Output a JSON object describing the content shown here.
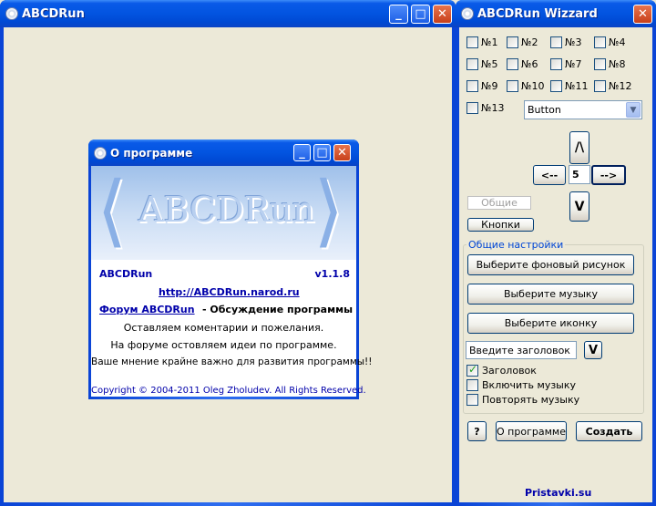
{
  "main_window": {
    "title": "ABCDRun"
  },
  "about_dialog": {
    "title": "О программе",
    "banner_text": "ABCDRun",
    "app_name": "ABCDRun",
    "version": "v1.1.8",
    "site_link": "http://ABCDRun.narod.ru",
    "forum_link": "Форум ABCDRun",
    "forum_desc": " - Обсуждение программы",
    "line1": "Оставляем коментарии и пожелания.",
    "line2": "На форуме остовляем идеи по программе.",
    "line3": "Ваше мнение крайне важно для развития программы!!",
    "copyright": "Copyright © 2004-2011 Oleg Zholudev. All Rights Reserved."
  },
  "wizard": {
    "title": "ABCDRun Wizzard",
    "checkboxes": [
      "№1",
      "№2",
      "№3",
      "№4",
      "№5",
      "№6",
      "№7",
      "№8",
      "№9",
      "№10",
      "№11",
      "№12",
      "№13"
    ],
    "style_select": "Button",
    "up_label": "/\\",
    "down_label": "V",
    "left_label": "<--",
    "right_label": "-->",
    "step_value": "5",
    "general_disabled": "Общие",
    "buttons_label": "Кнопки",
    "settings_group": "Общие настройки",
    "bg_button": "Выберите фоновый рисунок",
    "music_button": "Выберите музыку",
    "icon_button": "Выберите иконку",
    "title_input": "Введите заголовок",
    "title_dropdown": "V",
    "chk_title": "Заголовок",
    "chk_music": "Включить музыку",
    "chk_repeat": "Повторять музыку",
    "help_button": "?",
    "about_button": "О программе",
    "create_button": "Создать",
    "footer": "Pristavki.su"
  }
}
